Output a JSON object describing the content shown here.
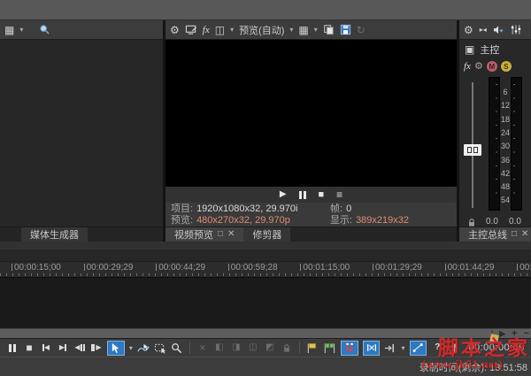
{
  "left_panel": {
    "tab_label": "媒体生成器"
  },
  "preview_panel": {
    "preview_mode_label": "预览(自动)",
    "info": {
      "project_label": "项目:",
      "project_value": "1920x1080x32, 29.970i",
      "preview_label": "预览:",
      "preview_value": "480x270x32, 29.970p",
      "frame_label": "帧:",
      "frame_value": "0",
      "display_label": "显示:",
      "display_value": "389x219x32"
    },
    "tabs": {
      "video_preview": "视频预览",
      "trimmer": "修剪器"
    }
  },
  "mixer_panel": {
    "master_label": "主控",
    "mute_letter": "M",
    "solo_letter": "S",
    "db_scale": [
      "6",
      "12",
      "18",
      "24",
      "30",
      "36",
      "42",
      "48",
      "54"
    ],
    "fader_value_left": "0.0",
    "fader_value_right": "0.0",
    "tab_label": "主控总线"
  },
  "timeline": {
    "ruler_labels": [
      "00:00:15;00",
      "00:00:29;29",
      "00:00:44;29",
      "00:00:59;28",
      "00:01:15;00",
      "00:01:29;29",
      "00:01:44;29",
      "00:0"
    ]
  },
  "transport_bar": {
    "timecode": "00:00:00;00"
  },
  "status_bar": {
    "recording_time_text": "录制时间(剩余): 13:51:58"
  },
  "watermark": {
    "title": "脚本之家",
    "url": "(www.jb51.net)"
  },
  "colors": {
    "accent_blue": "#2f79c2",
    "salmon_value": "#e08a76",
    "watermark_red": "#cb2b2b"
  }
}
